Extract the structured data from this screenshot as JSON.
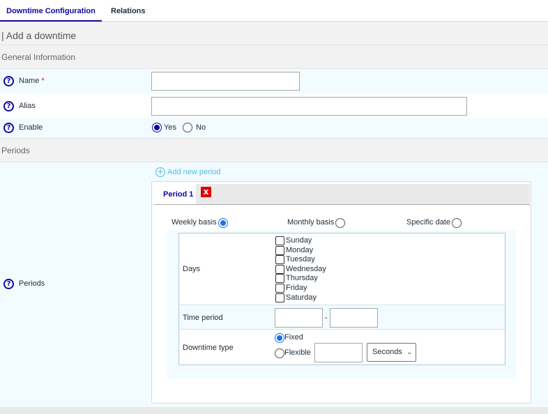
{
  "tabs": [
    {
      "label": "Downtime Configuration"
    },
    {
      "label": "Relations"
    }
  ],
  "page_title": "| Add a downtime",
  "sections": {
    "general": "General Information",
    "periods": "Periods"
  },
  "fields": {
    "name_label": "Name",
    "name_required": "*",
    "name_value": "",
    "alias_label": "Alias",
    "alias_value": "",
    "enable_label": "Enable",
    "enable_yes": "Yes",
    "enable_no": "No",
    "enable_selected": "Yes",
    "periods_label": "Periods"
  },
  "add_period_label": "Add new period",
  "period": {
    "tab_label": "Period 1",
    "delete_icon": "x",
    "basis": {
      "weekly": "Weekly basis",
      "monthly": "Monthly basis",
      "specific": "Specific date",
      "selected": "Weekly basis"
    },
    "days_label": "Days",
    "days": [
      "Sunday",
      "Monday",
      "Tuesday",
      "Wednesday",
      "Thursday",
      "Friday",
      "Saturday"
    ],
    "time_period_label": "Time period",
    "time_separator": "-",
    "time_start": "",
    "time_end": "",
    "downtime_type_label": "Downtime type",
    "type_fixed": "Fixed",
    "type_flexible": "Flexible",
    "type_selected": "Fixed",
    "duration_value": "",
    "duration_unit": "Seconds"
  },
  "colors": {
    "accent": "#10069f",
    "link": "#4dbde6",
    "delete": "#e00000"
  }
}
